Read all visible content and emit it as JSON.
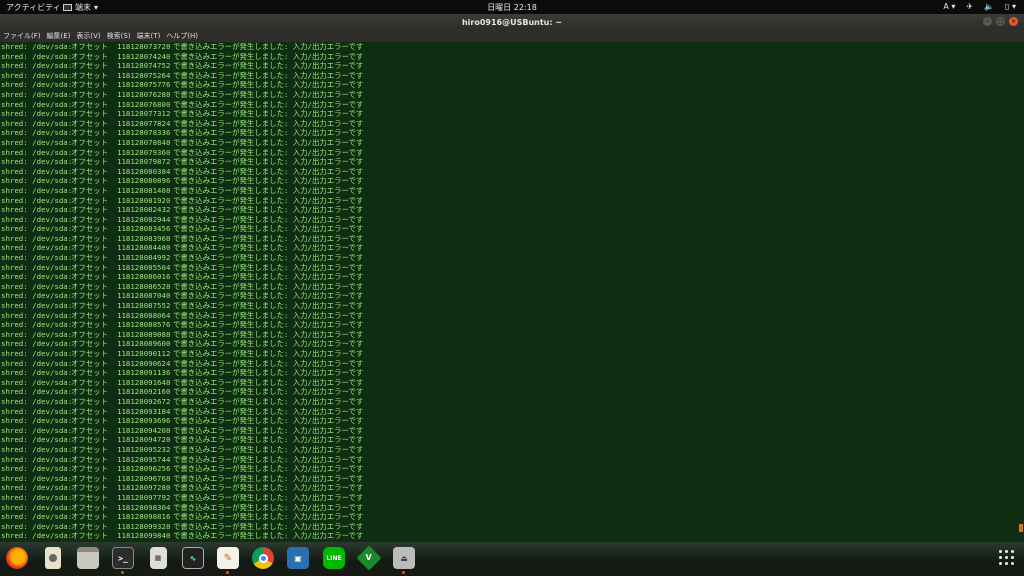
{
  "topbar": {
    "activities": "アクティビティ",
    "app_menu": "端末",
    "clock": "日曜日 22:18",
    "input_method": "A"
  },
  "window": {
    "title": "hiro0916@USBuntu: ~"
  },
  "menu": [
    "ファイル(F)",
    "編集(E)",
    "表示(V)",
    "検索(S)",
    "端末(T)",
    "ヘルプ(H)"
  ],
  "terminal": {
    "prefix": "shred: /dev/sda:",
    "offset_label": "オフセット",
    "message": "で書き込みエラーが発生しました: 入力/出力エラーです",
    "offsets": [
      "118128073728",
      "118128074240",
      "118128074752",
      "118128075264",
      "118128075776",
      "118128076288",
      "118128076800",
      "118128077312",
      "118128077824",
      "118128078336",
      "118128078848",
      "118128079360",
      "118128079872",
      "118128080384",
      "118128080896",
      "118128081408",
      "118128081920",
      "118128082432",
      "118128082944",
      "118128083456",
      "118128083968",
      "118128084480",
      "118128084992",
      "118128085504",
      "118128086016",
      "118128086528",
      "118128087040",
      "118128087552",
      "118128088064",
      "118128088576",
      "118128089088",
      "118128089600",
      "118128090112",
      "118128090624",
      "118128091136",
      "118128091648",
      "118128092160",
      "118128092672",
      "118128093184",
      "118128093696",
      "118128094208",
      "118128094720",
      "118128095232",
      "118128095744",
      "118128096256",
      "118128096768",
      "118128097280",
      "118128097792",
      "118128098304",
      "118128098816",
      "118128099328",
      "118128099840"
    ]
  },
  "dock": {
    "apps": [
      "firefox",
      "disks",
      "files",
      "terminal",
      "calculator",
      "system-monitor",
      "text-editor",
      "chrome",
      "remmina",
      "line",
      "vim",
      "usb-creator"
    ],
    "running": [
      "terminal",
      "text-editor",
      "usb-creator"
    ]
  }
}
